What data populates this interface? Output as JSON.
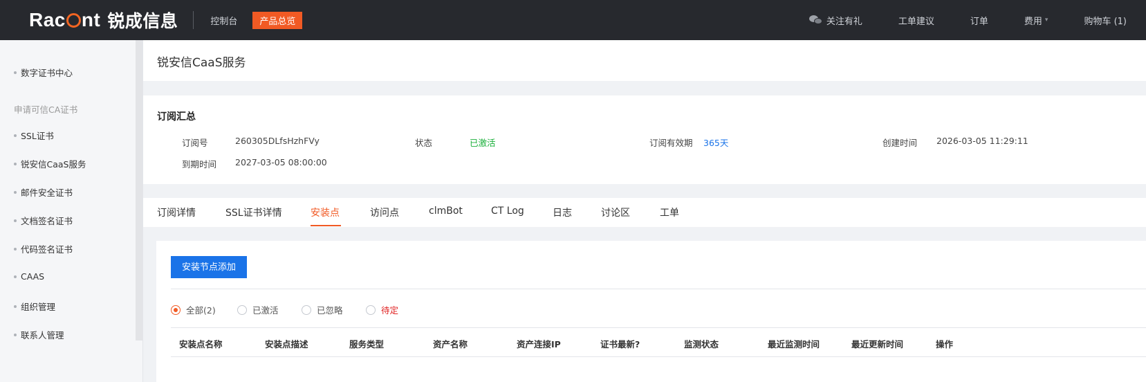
{
  "topbar": {
    "brand_latin": "Racent",
    "brand_cn": "锐成信息",
    "nav_console": "控制台",
    "nav_products": "产品总览",
    "follow": "关注有礼",
    "ticket_suggest": "工单建议",
    "orders": "订单",
    "fees": "费用",
    "cart": "购物车 (1)"
  },
  "sidebar": {
    "items": [
      {
        "label": "数字证书中心",
        "type": "item"
      },
      {
        "label": "申请可信CA证书",
        "type": "group"
      },
      {
        "label": "SSL证书",
        "type": "item"
      },
      {
        "label": "锐安信CaaS服务",
        "type": "item"
      },
      {
        "label": "邮件安全证书",
        "type": "item"
      },
      {
        "label": "文档签名证书",
        "type": "item"
      },
      {
        "label": "代码签名证书",
        "type": "item"
      },
      {
        "label": "CAAS",
        "type": "item"
      },
      {
        "label": "组织管理",
        "type": "item"
      },
      {
        "label": "联系人管理",
        "type": "item"
      }
    ]
  },
  "page": {
    "title": "锐安信CaaS服务"
  },
  "summary": {
    "title": "订阅汇总",
    "sub_id_label": "订阅号",
    "sub_id": "260305DLfsHzhFVy",
    "status_label": "状态",
    "status": "已激活",
    "validity_label": "订阅有效期",
    "validity": "365天",
    "created_label": "创建时间",
    "created": "2026-03-05 11:29:11",
    "expire_label": "到期时间",
    "expire": "2027-03-05 08:00:00"
  },
  "tabs": [
    {
      "label": "订阅详情",
      "active": false
    },
    {
      "label": "SSL证书详情",
      "active": false
    },
    {
      "label": "安装点",
      "active": true
    },
    {
      "label": "访问点",
      "active": false
    },
    {
      "label": "clmBot",
      "active": false
    },
    {
      "label": "CT Log",
      "active": false
    },
    {
      "label": "日志",
      "active": false
    },
    {
      "label": "讨论区",
      "active": false
    },
    {
      "label": "工单",
      "active": false
    }
  ],
  "install": {
    "add_button": "安装节点添加",
    "filters": [
      {
        "label": "全部(2)",
        "checked": true
      },
      {
        "label": "已激活",
        "checked": false
      },
      {
        "label": "已忽略",
        "checked": false
      },
      {
        "label": "待定",
        "checked": false
      }
    ],
    "columns": [
      "安装点名称",
      "安装点描述",
      "服务类型",
      "资产名称",
      "资产连接IP",
      "证书最新?",
      "监测状态",
      "最近监测时间",
      "最近更新时间",
      "操作"
    ]
  },
  "colors": {
    "accent": "#f15a24",
    "primary_blue": "#1a73e8",
    "active_green": "#1aaf3a",
    "pending_red": "#e02020",
    "topbar_bg": "#27292e"
  }
}
